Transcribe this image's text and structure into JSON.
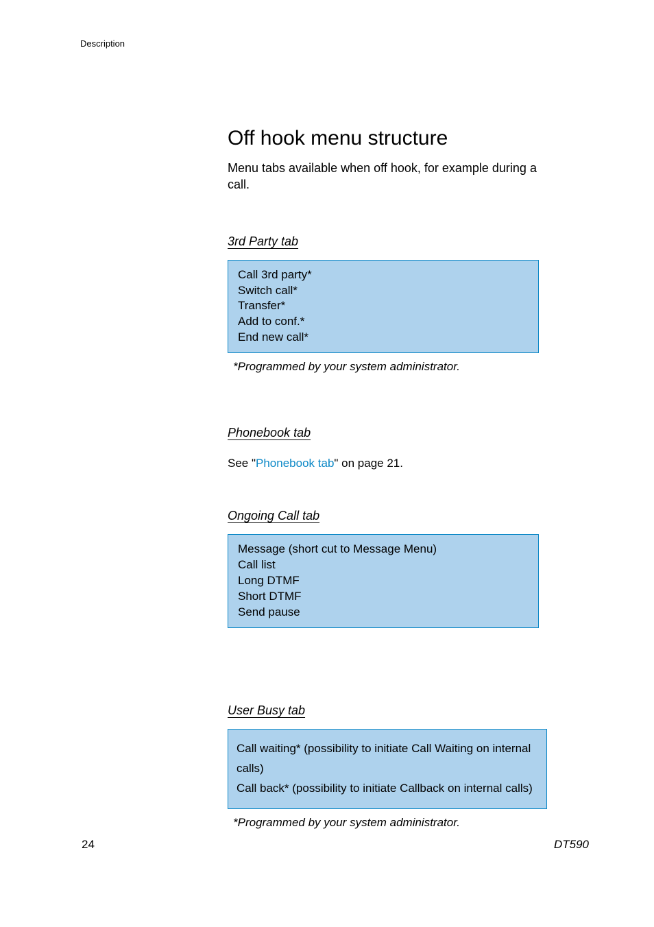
{
  "header": {
    "section": "Description"
  },
  "title": "Off hook menu structure",
  "intro": "Menu tabs available when off hook, for example during a call.",
  "thirdParty": {
    "heading": "3rd Party tab",
    "items": [
      "Call 3rd party*",
      "Switch call*",
      "Transfer*",
      "Add to conf.*",
      "End new call*"
    ],
    "footnote": "*Programmed by your system administrator."
  },
  "phonebook": {
    "heading": "Phonebook tab",
    "ref_pre": "See \"",
    "ref_link": "Phonebook tab",
    "ref_post": "\" on page 21."
  },
  "ongoing": {
    "heading": "Ongoing Call tab",
    "items": [
      "Message (short cut to Message Menu)",
      "Call list",
      "Long DTMF",
      "Short DTMF",
      "Send pause"
    ]
  },
  "userBusy": {
    "heading": "User Busy tab",
    "items": [
      "Call waiting* (possibility to initiate Call Waiting on internal calls)",
      "Call back* (possibility to initiate Callback on internal calls)"
    ],
    "footnote": "*Programmed by your system administrator."
  },
  "footer": {
    "pageNumber": "24",
    "model": "DT590"
  }
}
